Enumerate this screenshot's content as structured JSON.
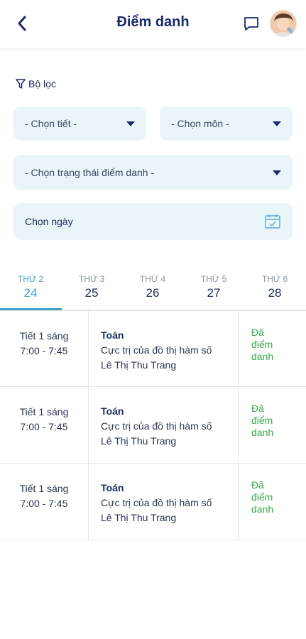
{
  "header": {
    "title": "Điểm danh",
    "back_icon": "chevron-left-icon",
    "chat_icon": "chat-bubble-icon",
    "avatar": "user-avatar"
  },
  "filter": {
    "label": "Bộ lọc",
    "tiet_placeholder": "- Chọn tiết -",
    "mon_placeholder": "- Chọn môn -",
    "status_placeholder": "- Chọn trạng thái điểm danh -",
    "date_placeholder": "Chọn ngày"
  },
  "tabs": [
    {
      "dow": "THỨ 2",
      "day": "24",
      "active": true
    },
    {
      "dow": "THỨ 3",
      "day": "25",
      "active": false
    },
    {
      "dow": "THỨ 4",
      "day": "26",
      "active": false
    },
    {
      "dow": "THỨ 5",
      "day": "27",
      "active": false
    },
    {
      "dow": "THỨ 6",
      "day": "28",
      "active": false
    }
  ],
  "rows": [
    {
      "period": "Tiết 1 sáng",
      "time": "7:00 - 7:45",
      "subject": "Toán",
      "topic": "Cực trị của đồ thị hàm số",
      "teacher": "Lê Thị Thu Trang",
      "status": "Đã điểm danh"
    },
    {
      "period": "Tiết 1 sáng",
      "time": "7:00 - 7:45",
      "subject": "Toán",
      "topic": "Cực trị của đồ thị hàm số",
      "teacher": "Lê Thị Thu Trang",
      "status": "Đã điểm danh"
    },
    {
      "period": "Tiết 1 sáng",
      "time": "7:00 - 7:45",
      "subject": "Toán",
      "topic": "Cực trị của đồ thị hàm số",
      "teacher": "Lê Thị Thu Trang",
      "status": "Đã điểm danh"
    }
  ],
  "colors": {
    "primary": "#1b2a6b",
    "accent": "#3ba3c8",
    "field_bg": "#eaf5f9",
    "status_green": "#3aa84a"
  }
}
